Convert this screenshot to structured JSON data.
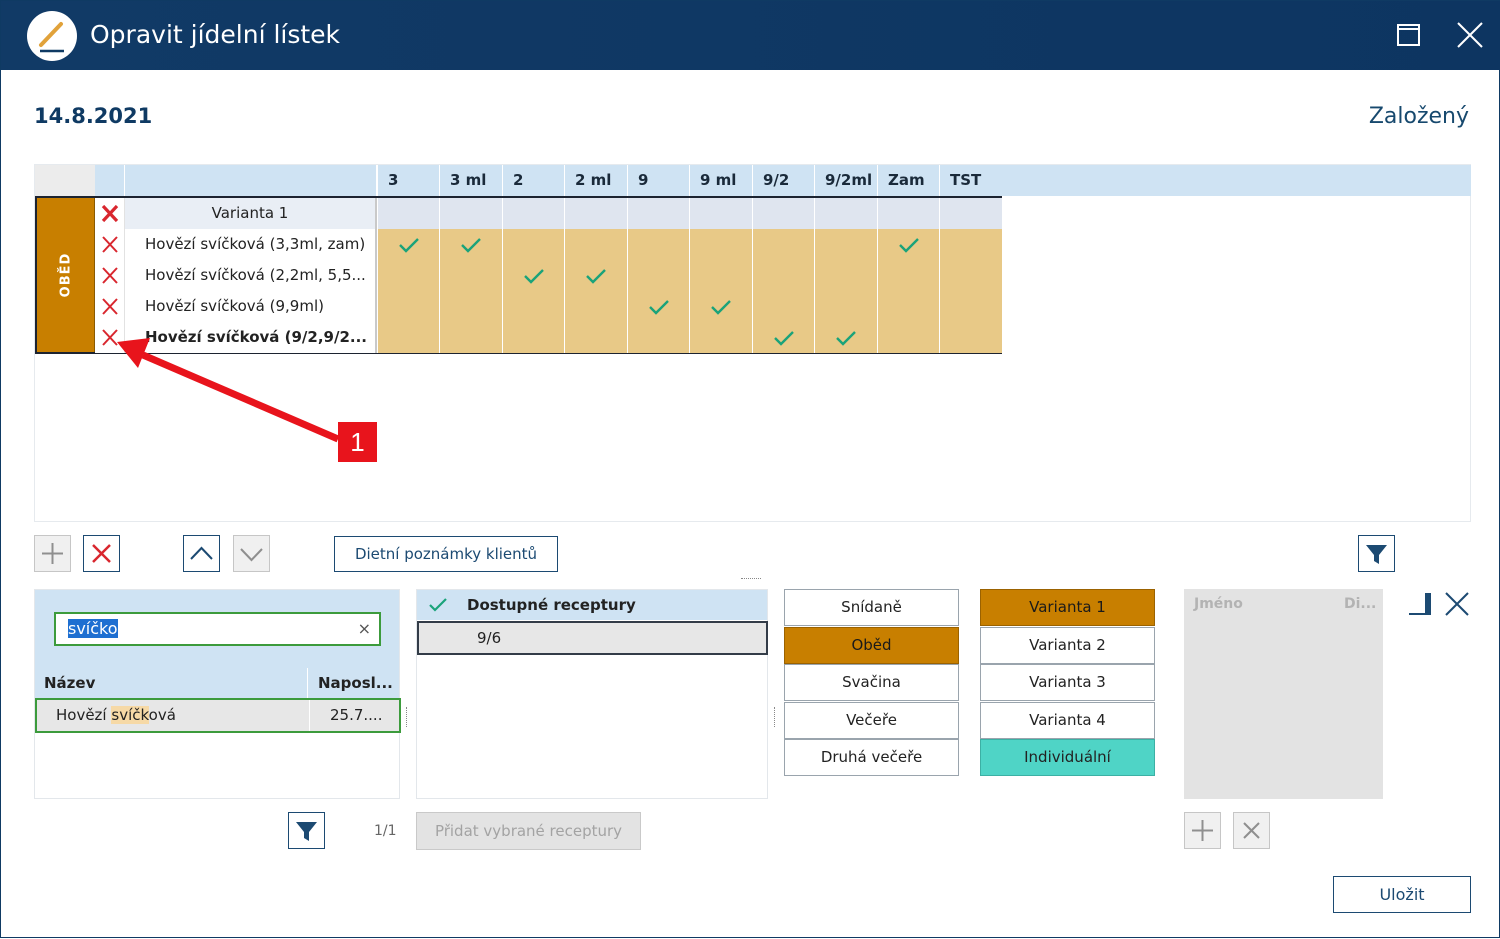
{
  "window": {
    "title": "Opravit jídelní lístek"
  },
  "header": {
    "date": "14.8.2021",
    "status": "Založený"
  },
  "grid": {
    "columns": [
      "3",
      "3 ml",
      "2",
      "2 ml",
      "9",
      "9 ml",
      "9/2",
      "9/2ml",
      "Zam",
      "TST"
    ],
    "group_label": "OBĚD",
    "rows": [
      {
        "name": "Varianta 1",
        "type": "variant",
        "checks": [
          false,
          false,
          false,
          false,
          false,
          false,
          false,
          false,
          false,
          false
        ]
      },
      {
        "name": "Hovězí svíčková (3,3ml, zam)",
        "type": "dish",
        "checks": [
          true,
          true,
          false,
          false,
          false,
          false,
          false,
          false,
          true,
          false
        ]
      },
      {
        "name": "Hovězí svíčková (2,2ml, 5,5...",
        "type": "dish",
        "checks": [
          false,
          false,
          true,
          true,
          false,
          false,
          false,
          false,
          false,
          false
        ]
      },
      {
        "name": "Hovězí svíčková (9,9ml)",
        "type": "dish",
        "checks": [
          false,
          false,
          false,
          false,
          true,
          true,
          false,
          false,
          false,
          false
        ]
      },
      {
        "name": "Hovězí svíčková (9/2,9/2...",
        "type": "dish",
        "bold": true,
        "checks": [
          false,
          false,
          false,
          false,
          false,
          false,
          true,
          true,
          false,
          false
        ]
      }
    ]
  },
  "annotation": {
    "badge": "1"
  },
  "toolbar": {
    "diet_notes_label": "Dietní poznámky klientů"
  },
  "search": {
    "value": "svíčko",
    "columns": [
      "Název",
      "Naposl..."
    ],
    "results": [
      {
        "name_prefix": "Hovězí ",
        "name_match": "svíčk",
        "name_suffix": "ová",
        "last": "25.7...."
      }
    ],
    "pager": "1/1",
    "add_selected_label": "Přidat vybrané receptury"
  },
  "recipes": {
    "header": "Dostupné receptury",
    "items": [
      "9/6"
    ]
  },
  "meals": [
    "Snídaně",
    "Oběd",
    "Svačina",
    "Večeře",
    "Druhá večeře"
  ],
  "meal_selected": "Oběd",
  "variants": [
    "Varianta 1",
    "Varianta 2",
    "Varianta 3",
    "Varianta 4",
    "Individuální"
  ],
  "variant_selected": "Varianta 1",
  "clients": {
    "col_name": "Jméno",
    "col_diet": "Di..."
  },
  "footer": {
    "save_label": "Uložit"
  },
  "colors": {
    "titlebar": "#113a66",
    "accent_orange": "#c87f00",
    "teal": "#4fd4c6",
    "check_green": "#1aa37a",
    "delete_red": "#d9262e"
  }
}
